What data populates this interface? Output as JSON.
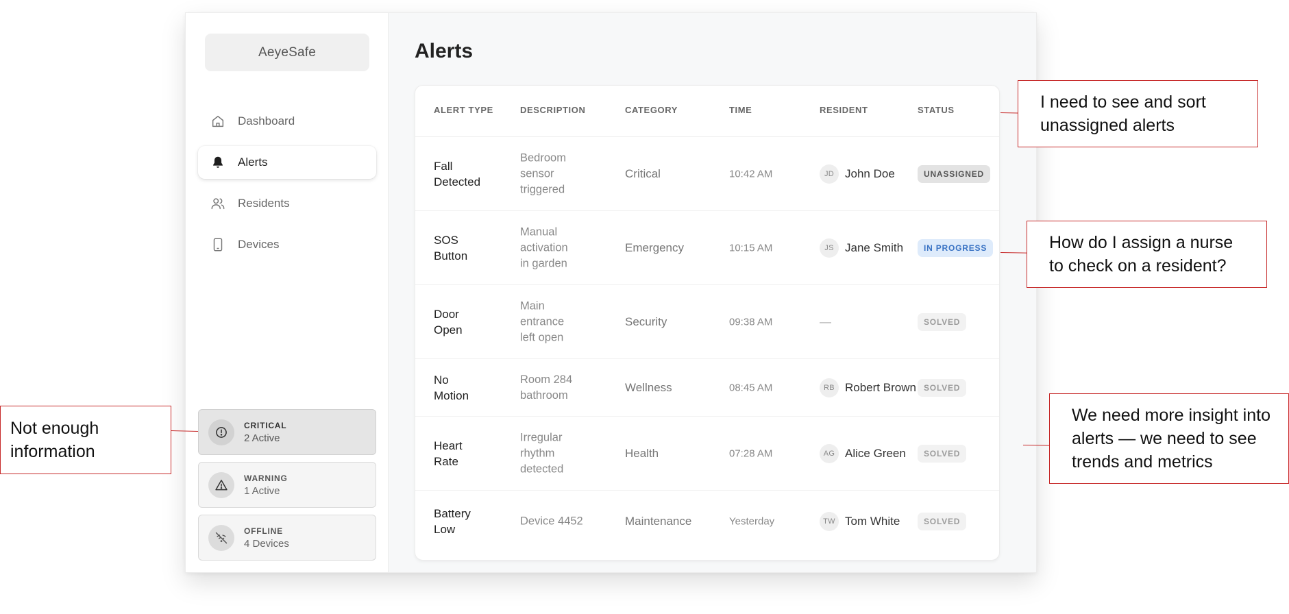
{
  "app": {
    "logo": "AeyeSafe",
    "nav": [
      {
        "label": "Dashboard",
        "icon": "home-icon"
      },
      {
        "label": "Alerts",
        "icon": "bell-icon"
      },
      {
        "label": "Residents",
        "icon": "users-icon"
      },
      {
        "label": "Devices",
        "icon": "tablet-icon"
      }
    ],
    "active_nav": "Alerts",
    "stats": [
      {
        "label": "CRITICAL",
        "value": "2 Active",
        "icon": "alert-circle-icon"
      },
      {
        "label": "WARNING",
        "value": "1 Active",
        "icon": "alert-triangle-icon"
      },
      {
        "label": "OFFLINE",
        "value": "4 Devices",
        "icon": "wifi-off-icon"
      }
    ]
  },
  "main": {
    "title": "Alerts",
    "columns": [
      "ALERT TYPE",
      "DESCRIPTION",
      "CATEGORY",
      "TIME",
      "RESIDENT",
      "STATUS"
    ],
    "rows": [
      {
        "type": [
          "Fall",
          "Detected"
        ],
        "description": [
          "Bedroom",
          "sensor",
          "triggered"
        ],
        "category": "Critical",
        "time": "10:42 AM",
        "initials": "JD",
        "resident": "John Doe",
        "status": "UNASSIGNED"
      },
      {
        "type": [
          "SOS",
          "Button"
        ],
        "description": [
          "Manual",
          "activation",
          "in garden"
        ],
        "category": "Emergency",
        "time": "10:15 AM",
        "initials": "JS",
        "resident": "Jane Smith",
        "status": "IN PROGRESS"
      },
      {
        "type": [
          "Door",
          "Open"
        ],
        "description": [
          "Main",
          "entrance",
          "left open"
        ],
        "category": "Security",
        "time": "09:38 AM",
        "initials": "",
        "resident": "—",
        "status": "SOLVED"
      },
      {
        "type": [
          "No",
          "Motion"
        ],
        "description": [
          "Room 284",
          "bathroom"
        ],
        "category": "Wellness",
        "time": "08:45 AM",
        "initials": "RB",
        "resident": "Robert Brown",
        "status": "SOLVED"
      },
      {
        "type": [
          "Heart",
          "Rate"
        ],
        "description": [
          "Irregular",
          "rhythm",
          "detected"
        ],
        "category": "Health",
        "time": "07:28 AM",
        "initials": "AG",
        "resident": "Alice Green",
        "status": "SOLVED"
      },
      {
        "type": [
          "Battery",
          "Low"
        ],
        "description": [
          "Device 4452"
        ],
        "category": "Maintenance",
        "time": "Yesterday",
        "initials": "TW",
        "resident": "Tom White",
        "status": "SOLVED"
      }
    ]
  },
  "annotations": {
    "info": "Not enough information",
    "sort": "I need to see and sort unassigned alerts",
    "assign": "How do I assign a nurse to check on a resident?",
    "insight": "We need more insight into alerts — we need to see trends and metrics"
  },
  "colors": {
    "annotation_border": "#c62828",
    "in_progress_bg": "#deebfb",
    "in_progress_text": "#3a73c4"
  }
}
